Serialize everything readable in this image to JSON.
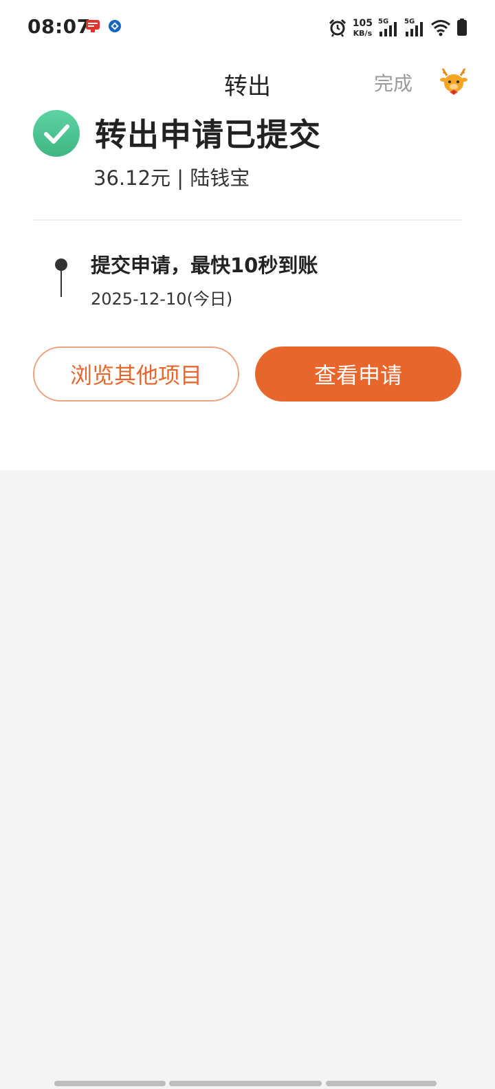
{
  "status_bar": {
    "time": "08:07",
    "net_speed_value": "105",
    "net_speed_unit": "KB/s",
    "signal1_label": "5G",
    "signal2_label": "5G",
    "icons": [
      "alarm-icon",
      "signal-icon",
      "signal-icon",
      "wifi-icon",
      "battery-icon"
    ]
  },
  "header": {
    "title": "转出",
    "done_label": "完成",
    "mascot_icon": "deer-mascot-icon"
  },
  "result": {
    "title": "转出申请已提交",
    "amount_line": "36.12元 | 陆钱宝"
  },
  "timeline": {
    "items": [
      {
        "title": "提交申请，最快10秒到账",
        "date": "2025-12-10(今日)"
      }
    ]
  },
  "actions": {
    "browse_label": "浏览其他项目",
    "view_label": "查看申请"
  },
  "colors": {
    "accent": "#e8652c",
    "success": "#4cc494",
    "muted_text": "#9a9a9a"
  }
}
